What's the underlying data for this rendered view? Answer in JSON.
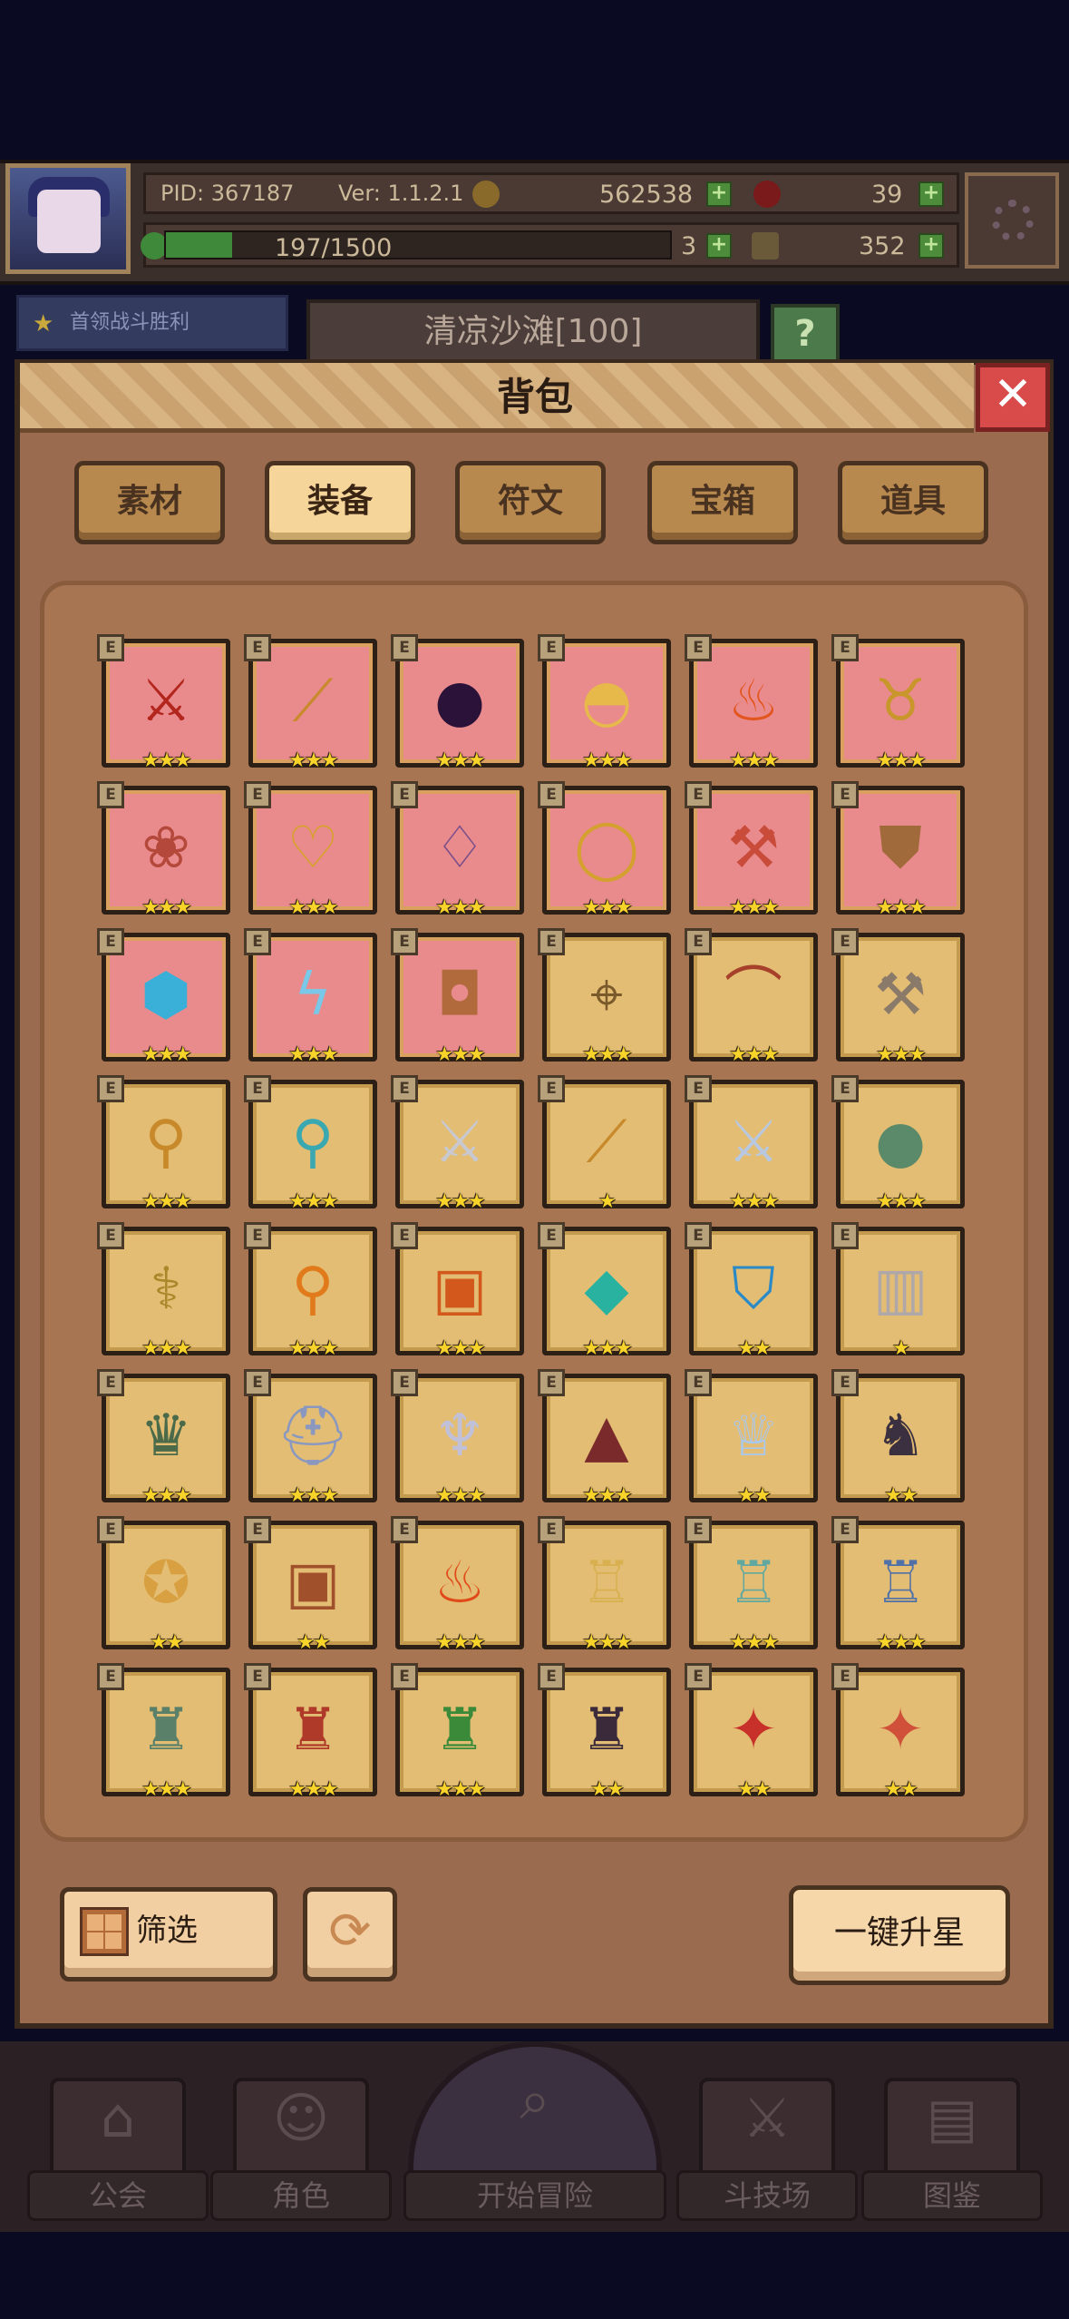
{
  "hud": {
    "pid": "PID: 367187",
    "version": "Ver: 1.1.2.1",
    "gold": "562538",
    "gems": "39",
    "stamina": "197/1500",
    "stamina_fraction": 0.131,
    "clover": "3",
    "keys": "352"
  },
  "quest": {
    "label": "首领战斗胜利"
  },
  "stage": {
    "name": "清凉沙滩[100]"
  },
  "panel": {
    "title": "背包",
    "close": "✕",
    "tabs": [
      {
        "label": "素材",
        "active": false
      },
      {
        "label": "装备",
        "active": true
      },
      {
        "label": "符文",
        "active": false
      },
      {
        "label": "宝箱",
        "active": false
      },
      {
        "label": "道具",
        "active": false
      }
    ]
  },
  "items": [
    {
      "name": "crossed-red-blades",
      "bg": "red",
      "stars": 3,
      "glyph": "⚔",
      "color": "#b3261e"
    },
    {
      "name": "wooden-staff",
      "bg": "red",
      "stars": 3,
      "glyph": "⟋",
      "color": "#c98a2e"
    },
    {
      "name": "dark-orb",
      "bg": "red",
      "stars": 3,
      "glyph": "●",
      "color": "#2a1238"
    },
    {
      "name": "straw-hat",
      "bg": "red",
      "stars": 3,
      "glyph": "◓",
      "color": "#e7b94a"
    },
    {
      "name": "flame-crown",
      "bg": "red",
      "stars": 3,
      "glyph": "♨",
      "color": "#e2551c"
    },
    {
      "name": "horned-helm",
      "bg": "red",
      "stars": 3,
      "glyph": "♉",
      "color": "#c9962c"
    },
    {
      "name": "red-cloak",
      "bg": "red",
      "stars": 3,
      "glyph": "❀",
      "color": "#b4483a"
    },
    {
      "name": "gold-heart-amulet",
      "bg": "red",
      "stars": 3,
      "glyph": "♡",
      "color": "#d6a22a"
    },
    {
      "name": "purple-necklace",
      "bg": "red",
      "stars": 3,
      "glyph": "♢",
      "color": "#7c4f8a"
    },
    {
      "name": "gold-ring",
      "bg": "red",
      "stars": 3,
      "glyph": "◯",
      "color": "#d4a02e"
    },
    {
      "name": "battle-axe",
      "bg": "red",
      "stars": 3,
      "glyph": "⚒",
      "color": "#c94b3a"
    },
    {
      "name": "bronze-chestplate",
      "bg": "red",
      "stars": 3,
      "glyph": "⛊",
      "color": "#a06a3a"
    },
    {
      "name": "ice-helmet",
      "bg": "red",
      "stars": 3,
      "glyph": "⬢",
      "color": "#3ab0d8"
    },
    {
      "name": "lightning-ribbon",
      "bg": "red",
      "stars": 3,
      "glyph": "ϟ",
      "color": "#7ac8e8"
    },
    {
      "name": "leather-pot",
      "bg": "red",
      "stars": 3,
      "glyph": "◘",
      "color": "#b06a3c"
    },
    {
      "name": "gold-crossbow",
      "bg": "gold",
      "stars": 3,
      "glyph": "⌖",
      "color": "#7a5a2a"
    },
    {
      "name": "red-bow",
      "bg": "gold",
      "stars": 3,
      "glyph": "⌒",
      "color": "#a6402a"
    },
    {
      "name": "silver-hammer",
      "bg": "gold",
      "stars": 3,
      "glyph": "⚒",
      "color": "#8a7a6a"
    },
    {
      "name": "golden-mace",
      "bg": "gold",
      "stars": 3,
      "glyph": "⚲",
      "color": "#c8892a"
    },
    {
      "name": "crystal-wand",
      "bg": "gold",
      "stars": 3,
      "glyph": "⚲",
      "color": "#3aa8b0"
    },
    {
      "name": "silver-sword",
      "bg": "gold",
      "stars": 3,
      "glyph": "⚔",
      "color": "#c8c8d0"
    },
    {
      "name": "golden-spear",
      "bg": "gold",
      "stars": 1,
      "glyph": "⟋",
      "color": "#c8892a"
    },
    {
      "name": "twin-blades",
      "bg": "gold",
      "stars": 3,
      "glyph": "⚔",
      "color": "#b8c8e0"
    },
    {
      "name": "green-orb",
      "bg": "gold",
      "stars": 3,
      "glyph": "●",
      "color": "#5a8a6a"
    },
    {
      "name": "vine-scepter",
      "bg": "gold",
      "stars": 3,
      "glyph": "⚕",
      "color": "#a8882a"
    },
    {
      "name": "fire-torch",
      "bg": "gold",
      "stars": 3,
      "glyph": "⚲",
      "color": "#e07a1a"
    },
    {
      "name": "lava-armor",
      "bg": "gold",
      "stars": 3,
      "glyph": "▣",
      "color": "#d2581c"
    },
    {
      "name": "emerald-gem",
      "bg": "gold",
      "stars": 3,
      "glyph": "◆",
      "color": "#2ab2a0"
    },
    {
      "name": "blue-shield",
      "bg": "gold",
      "stars": 2,
      "glyph": "⛉",
      "color": "#2a8ac8"
    },
    {
      "name": "stone-vest",
      "bg": "gold",
      "stars": 1,
      "glyph": "▥",
      "color": "#b0a8a8"
    },
    {
      "name": "gem-tiara",
      "bg": "gold",
      "stars": 3,
      "glyph": "♛",
      "color": "#4a6a4a"
    },
    {
      "name": "knight-helm",
      "bg": "gold",
      "stars": 3,
      "glyph": "⛑",
      "color": "#8a98c0"
    },
    {
      "name": "winged-helm",
      "bg": "gold",
      "stars": 3,
      "glyph": "♆",
      "color": "#c0c0d8"
    },
    {
      "name": "hooded-cowl",
      "bg": "gold",
      "stars": 3,
      "glyph": "▲",
      "color": "#7a2a2a"
    },
    {
      "name": "ice-crown",
      "bg": "gold",
      "stars": 2,
      "glyph": "♕",
      "color": "#a8c8f0"
    },
    {
      "name": "demon-helm",
      "bg": "gold",
      "stars": 2,
      "glyph": "♞",
      "color": "#3a3040"
    },
    {
      "name": "ruby-robe",
      "bg": "gold",
      "stars": 2,
      "glyph": "✪",
      "color": "#d8a040"
    },
    {
      "name": "bronze-armor",
      "bg": "gold",
      "stars": 2,
      "glyph": "▣",
      "color": "#a0502a"
    },
    {
      "name": "flame-mantle",
      "bg": "gold",
      "stars": 3,
      "glyph": "♨",
      "color": "#e04a1a"
    },
    {
      "name": "golden-robe",
      "bg": "gold",
      "stars": 3,
      "glyph": "♖",
      "color": "#d8b050"
    },
    {
      "name": "teal-cape",
      "bg": "gold",
      "stars": 3,
      "glyph": "♖",
      "color": "#60a8a0"
    },
    {
      "name": "steel-plate",
      "bg": "gold",
      "stars": 3,
      "glyph": "♖",
      "color": "#5070a8"
    },
    {
      "name": "jade-armor",
      "bg": "gold",
      "stars": 3,
      "glyph": "♜",
      "color": "#5a806a"
    },
    {
      "name": "royal-cloak",
      "bg": "gold",
      "stars": 3,
      "glyph": "♜",
      "color": "#b03a2a"
    },
    {
      "name": "forest-cape",
      "bg": "gold",
      "stars": 3,
      "glyph": "♜",
      "color": "#3a8a3a"
    },
    {
      "name": "dark-plate",
      "bg": "gold",
      "stars": 2,
      "glyph": "♜",
      "color": "#3a2a3a"
    },
    {
      "name": "ruby-breastplate",
      "bg": "gold",
      "stars": 2,
      "glyph": "✦",
      "color": "#c8302a"
    },
    {
      "name": "crimson-robe",
      "bg": "gold",
      "stars": 2,
      "glyph": "✦",
      "color": "#d0503a"
    }
  ],
  "controls": {
    "filter_label": "筛选",
    "refresh": "⟳",
    "upstar_label": "一键升星"
  },
  "nav": [
    {
      "label": "公会",
      "glyph": "⌂"
    },
    {
      "label": "角色",
      "glyph": "☺"
    },
    {
      "label": "开始冒险",
      "glyph": "⌕"
    },
    {
      "label": "斗技场",
      "glyph": "⚔"
    },
    {
      "label": "图鉴",
      "glyph": "▤"
    }
  ],
  "colors": {
    "panel_bg": "#9a6b4e",
    "red_cell": "#e98a8c",
    "gold_cell": "#e3bd73",
    "star": "#f8d32a"
  }
}
